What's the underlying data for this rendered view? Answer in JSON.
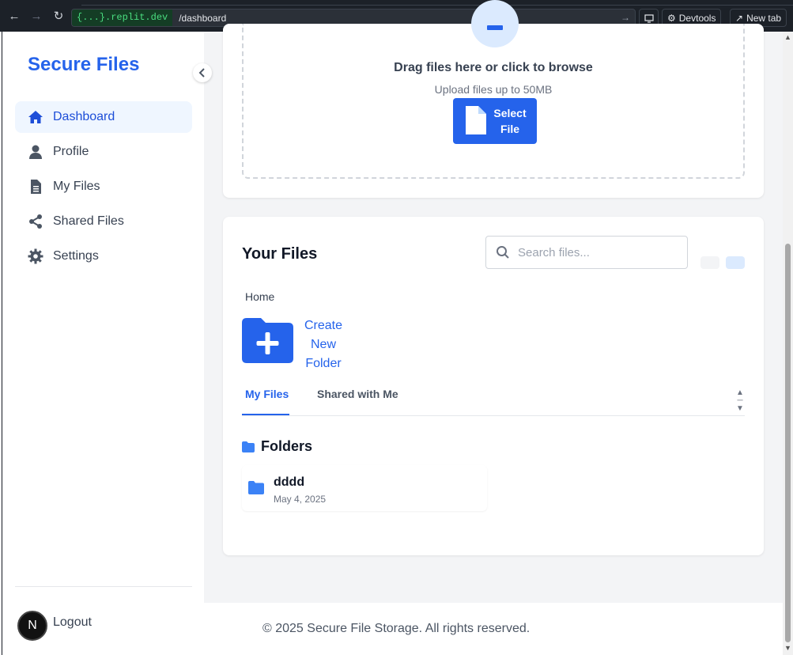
{
  "browser": {
    "url_domain": "{...}.replit.dev",
    "url_path": "/dashboard",
    "devtools_label": "Devtools",
    "newtab_label": "New tab"
  },
  "sidebar": {
    "brand": "Secure Files",
    "items": [
      {
        "label": "Dashboard",
        "icon": "home-icon",
        "active": true
      },
      {
        "label": "Profile",
        "icon": "user-icon",
        "active": false
      },
      {
        "label": "My Files",
        "icon": "file-icon",
        "active": false
      },
      {
        "label": "Shared Files",
        "icon": "share-icon",
        "active": false
      },
      {
        "label": "Settings",
        "icon": "gear-icon",
        "active": false
      }
    ],
    "logout_label": "Logout",
    "avatar_letter": "N"
  },
  "upload": {
    "title": "Drag files here or click to browse",
    "subtitle": "Upload files up to 50MB",
    "button_line1": "Select",
    "button_line2": "File"
  },
  "files": {
    "title": "Your Files",
    "search_placeholder": "Search files...",
    "breadcrumb": "Home",
    "create_folder_line1": "Create",
    "create_folder_line2": "New",
    "create_folder_line3": "Folder",
    "tabs": [
      {
        "label": "My Files",
        "active": true
      },
      {
        "label": "Shared with Me",
        "active": false
      }
    ],
    "folders_heading": "Folders",
    "folders": [
      {
        "name": "dddd",
        "date": "May 4, 2025"
      }
    ]
  },
  "footer": {
    "text": "© 2025 Secure File Storage. All rights reserved."
  },
  "colors": {
    "accent": "#2563eb",
    "active_bg": "#eff6ff",
    "url_green": "#4ade80"
  }
}
